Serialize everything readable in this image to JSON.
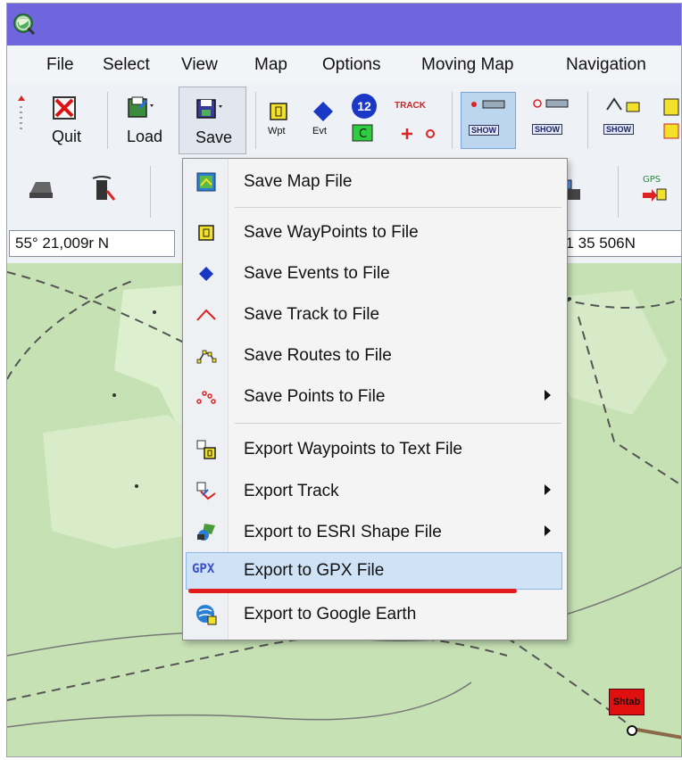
{
  "menubar": {
    "items": [
      "File",
      "Select",
      "View",
      "Map",
      "Options",
      "Moving Map",
      "Navigation"
    ]
  },
  "toolbar": {
    "quit_label": "Quit",
    "load_label": "Load",
    "save_label": "Save",
    "wpt_label": "Wpt",
    "evt_label": "Evt",
    "track_label": "TRACK",
    "event_number": "12",
    "show_label": "SHOW"
  },
  "coordinates": {
    "lat_text": "55° 21,009r N",
    "right_text": "61 35 506N"
  },
  "dropdown": {
    "items": [
      {
        "label": "Save Map File",
        "icon": "map-file-icon"
      },
      {
        "label": "Save WayPoints to File",
        "icon": "waypoint-icon"
      },
      {
        "label": "Save Events to File",
        "icon": "event-diamond-icon"
      },
      {
        "label": "Save Track to File",
        "icon": "track-icon"
      },
      {
        "label": "Save Routes to File",
        "icon": "route-icon"
      },
      {
        "label": "Save Points to File",
        "icon": "points-icon"
      },
      {
        "label": "Export Waypoints to Text File",
        "icon": "text-export-icon"
      },
      {
        "label": "Export Track",
        "icon": "export-track-icon"
      },
      {
        "label": "Export to ESRI Shape File",
        "icon": "esri-icon"
      },
      {
        "label": "Export to GPX File",
        "icon": "gpx-icon",
        "icon_text": "GPX"
      },
      {
        "label": "Export to Google Earth",
        "icon": "google-earth-icon"
      }
    ]
  },
  "map": {
    "marker_label": "Shtab"
  },
  "colors": {
    "titlebar": "#6f66dd",
    "highlight": "#cfe2f6",
    "underline": "#e41b1b",
    "map_bg": "#c6e1b4"
  }
}
